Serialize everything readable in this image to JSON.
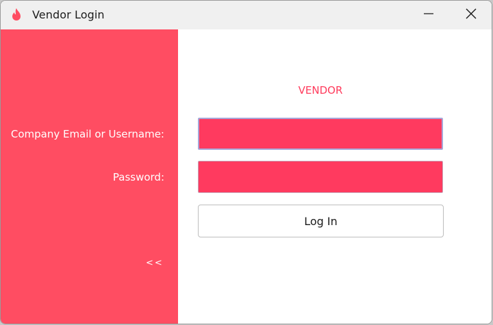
{
  "window": {
    "title": "Vendor Login"
  },
  "icons": {
    "app": "flame-icon",
    "minimize": "minimize-icon",
    "close": "close-icon"
  },
  "colors": {
    "accent": "#ff4d62",
    "field": "#ff3a5f",
    "heading": "#ff3b5c"
  },
  "form": {
    "heading": "VENDOR",
    "email_label": "Company Email or Username:",
    "email_value": "",
    "password_label": "Password:",
    "password_value": "",
    "login_label": "Log In",
    "back_label": "<<"
  }
}
